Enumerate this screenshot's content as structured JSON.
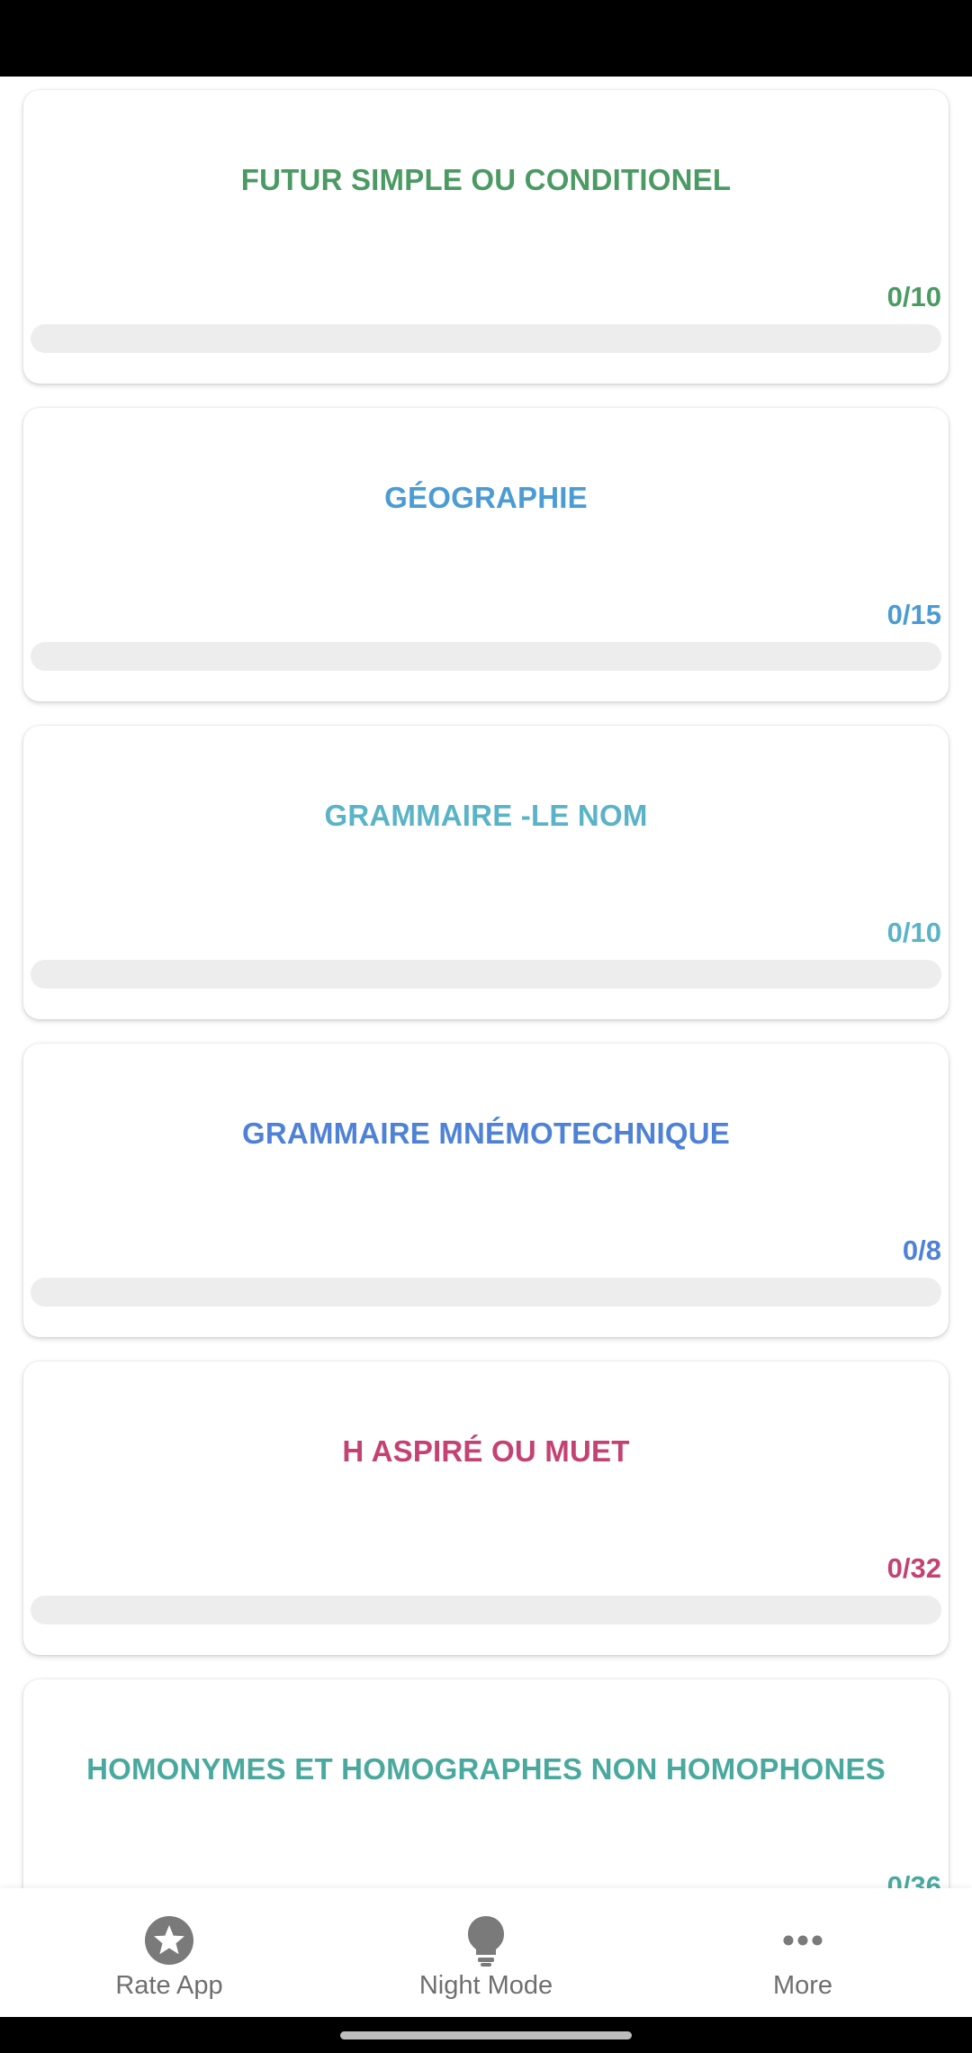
{
  "quizzes": [
    {
      "title": "FUTUR SIMPLE OU CONDITIONEL",
      "score": "0/10",
      "progress": 0,
      "color": "#4c9a63"
    },
    {
      "title": "GÉOGRAPHIE",
      "score": "0/15",
      "progress": 0,
      "color": "#4b9bd4"
    },
    {
      "title": "GRAMMAIRE -LE NOM",
      "score": "0/10",
      "progress": 0,
      "color": "#5ab3c7"
    },
    {
      "title": "GRAMMAIRE MNÉMOTECHNIQUE",
      "score": "0/8",
      "progress": 0,
      "color": "#4f82d6"
    },
    {
      "title": "H ASPIRÉ OU MUET",
      "score": "0/32",
      "progress": 0,
      "color": "#c44272"
    },
    {
      "title": "HOMONYMES ET HOMOGRAPHES NON HOMOPHONES",
      "score": "0/36",
      "progress": 0,
      "color": "#4aa99e"
    }
  ],
  "bottom_nav": {
    "items": [
      {
        "label": "Rate App",
        "icon": "star-icon"
      },
      {
        "label": "Night Mode",
        "icon": "lightbulb-icon"
      },
      {
        "label": "More",
        "icon": "more-horizontal-icon"
      }
    ]
  },
  "colors": {
    "track": "#eeeded",
    "nav_icon": "#7a7a7a",
    "nav_label": "#6f6f6f"
  }
}
